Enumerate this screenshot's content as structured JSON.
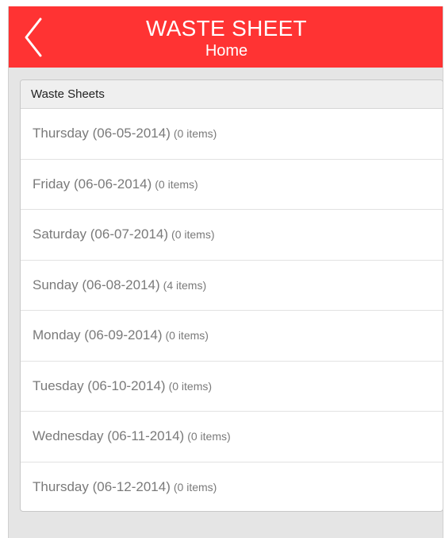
{
  "header": {
    "title": "WASTE SHEET",
    "subtitle": "Home",
    "back_icon": "chevron-left-icon",
    "background_color": "#ff3333"
  },
  "card": {
    "title": "Waste Sheets",
    "items": [
      {
        "day_date": "Thursday (06-05-2014)",
        "count": "(0 items)"
      },
      {
        "day_date": "Friday (06-06-2014)",
        "count": "(0 items)"
      },
      {
        "day_date": "Saturday (06-07-2014)",
        "count": "(0 items)"
      },
      {
        "day_date": "Sunday (06-08-2014)",
        "count": "(4 items)"
      },
      {
        "day_date": "Monday (06-09-2014)",
        "count": "(0 items)"
      },
      {
        "day_date": "Tuesday (06-10-2014)",
        "count": "(0 items)"
      },
      {
        "day_date": "Wednesday (06-11-2014)",
        "count": "(0 items)"
      },
      {
        "day_date": "Thursday (06-12-2014)",
        "count": "(0 items)"
      }
    ]
  }
}
